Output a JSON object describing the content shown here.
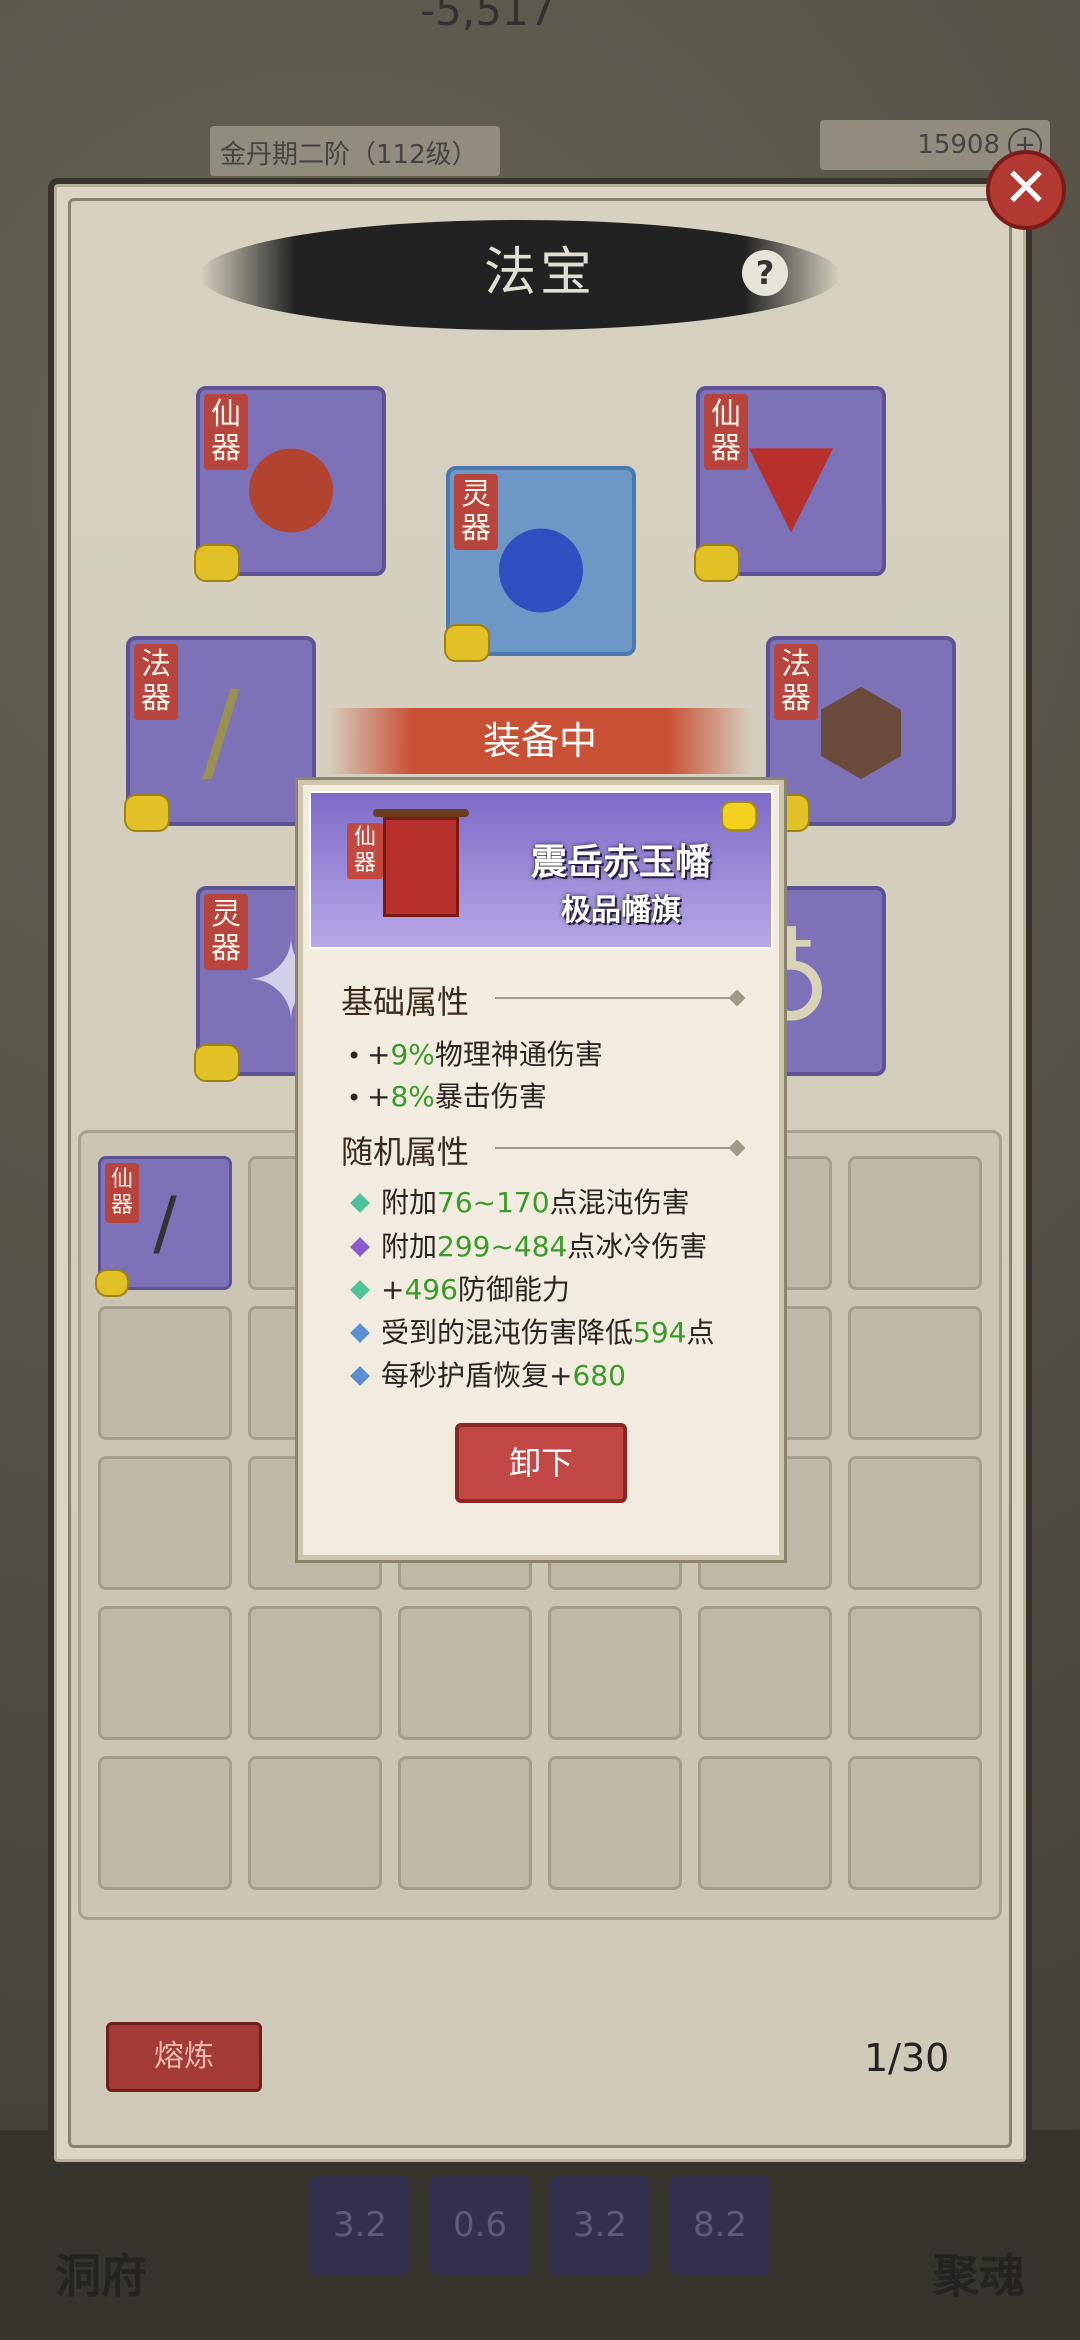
{
  "header": {
    "power_value": "-5,517",
    "realm": "金丹期二阶（112级）",
    "gems": "15908",
    "plus_label": "+"
  },
  "panel": {
    "title": "法宝",
    "help_label": "?",
    "close_label": "✕",
    "equip_banner": "装备中",
    "slots": [
      {
        "rank": "仙器",
        "icon": "gourd-icon"
      },
      {
        "rank": "灵器",
        "icon": "orb-icon"
      },
      {
        "rank": "仙器",
        "icon": "banner-icon"
      },
      {
        "rank": "法器",
        "icon": "sword-icon"
      },
      {
        "rank": "法器",
        "icon": "bagua-icon"
      },
      {
        "rank": "灵器",
        "icon": "feather-icon"
      }
    ],
    "bag": {
      "first_item_rank": "仙器",
      "first_item_icon": "blade-icon"
    },
    "smelt_label": "熔炼",
    "bag_count": "1/30"
  },
  "popup": {
    "rank": "仙器",
    "item_name": "震岳赤玉幡",
    "item_type": "极品幡旗",
    "base_title": "基础属性",
    "base_attrs": [
      {
        "prefix": "+",
        "value": "9%",
        "suffix": "物理神通伤害"
      },
      {
        "prefix": "+",
        "value": "8%",
        "suffix": "暴击伤害"
      }
    ],
    "random_title": "随机属性",
    "random_attrs": [
      {
        "color": "#4fc29a",
        "prefix": "附加",
        "value": "76~170",
        "suffix": "点混沌伤害"
      },
      {
        "color": "#8a5ccf",
        "prefix": "附加",
        "value": "299~484",
        "suffix": "点冰冷伤害"
      },
      {
        "color": "#4fc29a",
        "prefix": "+",
        "value": "496",
        "suffix": "防御能力"
      },
      {
        "color": "#5a8fd1",
        "prefix": "受到的混沌伤害降低",
        "value": "594",
        "suffix": "点"
      },
      {
        "color": "#5a8fd1",
        "prefix": "每秒护盾恢复+",
        "value": "680",
        "suffix": ""
      }
    ],
    "unequip_label": "卸下"
  },
  "footer": {
    "left_label": "洞府",
    "right_label": "聚魂",
    "skills": [
      "3.2",
      "0.6",
      "3.2",
      "8.2"
    ]
  }
}
